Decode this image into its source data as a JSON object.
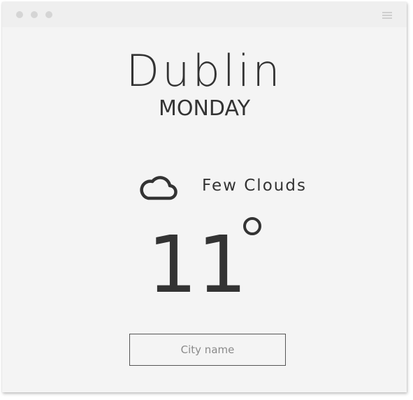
{
  "window": {
    "controls": [
      "close",
      "minimize",
      "maximize"
    ],
    "menu_icon": "hamburger-menu-icon"
  },
  "weather": {
    "city": "Dublin",
    "day": "MONDAY",
    "condition": "Few Clouds",
    "condition_icon": "cloud-icon",
    "temperature": "11"
  },
  "search": {
    "placeholder": "City name",
    "value": ""
  },
  "colors": {
    "background": "#f4f4f4",
    "titlebar": "#efefef",
    "text": "#333333",
    "window_dots": "#d5d5d5"
  }
}
